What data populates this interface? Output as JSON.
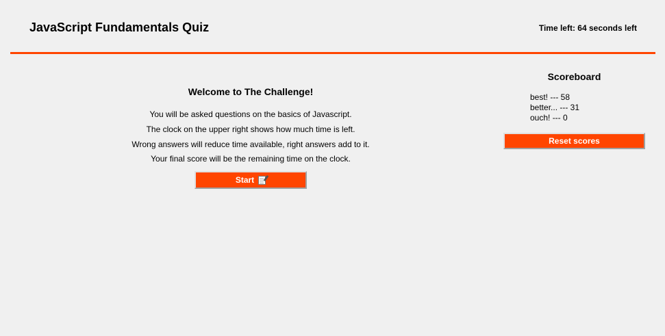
{
  "header": {
    "title": "JavaScript Fundamentals Quiz",
    "timer_text": "Time left: 64 seconds left"
  },
  "welcome": {
    "title": "Welcome to The Challenge!",
    "lines": [
      "You will be asked questions on the basics of Javascript.",
      "The clock on the upper right shows how much time is left.",
      "Wrong answers will reduce time available, right answers add to it.",
      "Your final score will be the remaining time on the clock."
    ],
    "start_label": "Start",
    "start_icon": "memo-icon"
  },
  "scoreboard": {
    "title": "Scoreboard",
    "scores": [
      "best! --- 58",
      "better... --- 31",
      "ouch! --- 0"
    ],
    "reset_label": "Reset scores"
  },
  "colors": {
    "accent": "#ff4500",
    "background": "#f0f0f0"
  }
}
